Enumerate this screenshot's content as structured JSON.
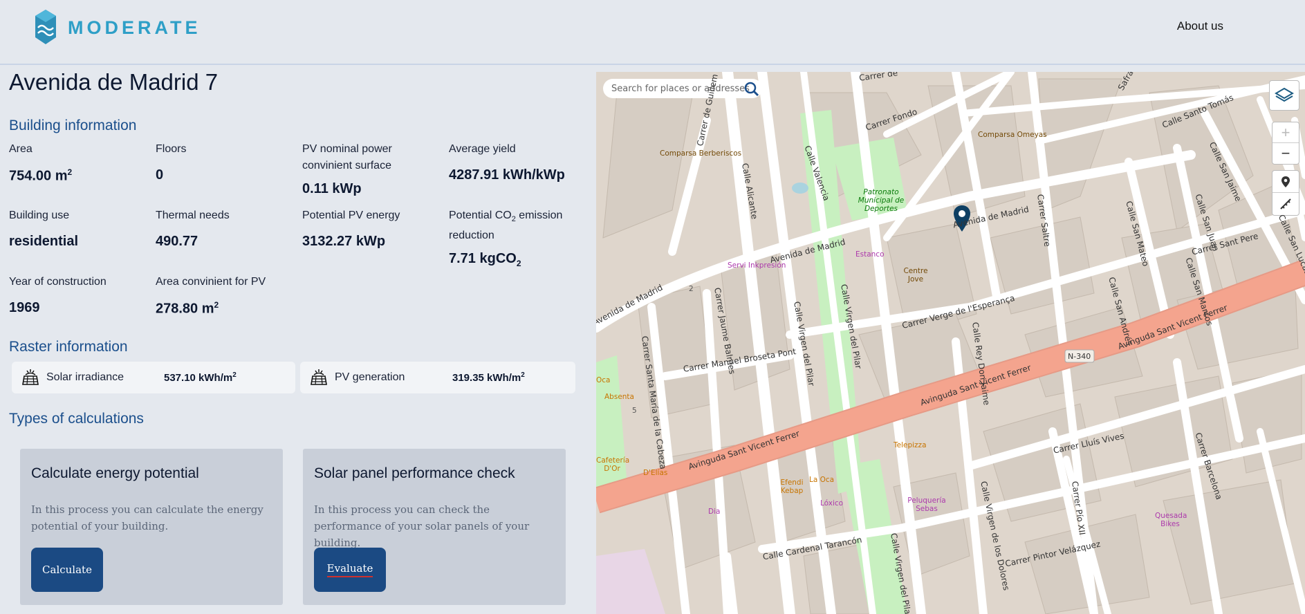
{
  "header": {
    "logo_text": "MODERATE",
    "nav_about": "About us"
  },
  "page_title": "Avenida de Madrid 7",
  "building": {
    "section_title": "Building information",
    "area_label": "Area",
    "area_value": "754.00 m",
    "area_unit_sup": "2",
    "floors_label": "Floors",
    "floors_value": "0",
    "pv_nominal_label": "PV nominal power convinient surface",
    "pv_nominal_value": "0.11 kWp",
    "avg_yield_label": "Average yield",
    "avg_yield_value": "4287.91 kWh/kWp",
    "use_label": "Building use",
    "use_value": "residential",
    "thermal_label": "Thermal needs",
    "thermal_value": "490.77",
    "pv_energy_label": "Potential PV energy",
    "pv_energy_value": "3132.27 kWp",
    "co2_label_pre": "Potential CO",
    "co2_label_sub": "2",
    "co2_label_post": " emission reduction",
    "co2_value": "7.71 kgCO",
    "co2_value_sub": "2",
    "year_label": "Year of construction",
    "year_value": "1969",
    "pv_area_label": "Area convinient for PV",
    "pv_area_value": "278.80 m",
    "pv_area_sup": "2"
  },
  "raster": {
    "section_title": "Raster information",
    "solar_label": "Solar irradiance",
    "solar_value": "537.10 kWh/m",
    "solar_sup": "2",
    "pvgen_label": "PV generation",
    "pvgen_value": "319.35 kWh/m",
    "pvgen_sup": "2"
  },
  "calculations": {
    "section_title": "Types of calculations",
    "card1_title": "Calculate energy potential",
    "card1_text": "In this process you can calculate the energy potential of your building.",
    "card1_button": "Calculate",
    "card2_title": "Solar panel performance check",
    "card2_text": "In this process you can check the performance of your solar panels of your building.",
    "card2_button": "Evaluate"
  },
  "map": {
    "search_placeholder": "Search for places or addresses",
    "zoom_in": "+",
    "zoom_out": "−",
    "streets": {
      "avenida_madrid_1": "Avenida de Madrid",
      "avenida_madrid_2": "Avenida de Madrid",
      "avenida_madrid_3": "Avenida de Madrid",
      "sant_vicent_1": "Avinguda Sant Vicent Ferrer",
      "sant_vicent_2": "Avinguda Sant Vicent Ferrer",
      "sant_vicent_3": "Avinguda Sant Vicent Ferrer",
      "n340": "N-340",
      "alicante": "Calle Alicante",
      "valencia": "Calle Valencia",
      "guillem": "Carrer de Guillem Magro",
      "fondo": "Carrer Fondo",
      "santo_tomas": "Calle Santo Tomás",
      "saltre": "Carrer Saltre",
      "verge": "Carrer Verge de l'Esperança",
      "broseta": "Carrer Manuel Broseta Pont",
      "jaume_balmes": "Carrer Jaume Balmes",
      "virgen_pilar_1": "Calle Virgen del Pilar",
      "virgen_pilar_2": "Calle Virgen del Pilar",
      "virgen_pilar_3": "Calle Virgen del Pilar",
      "santa_maria": "Carrer Santa María de la Cabeza",
      "rey_don_jaime": "Calle Rey Don Jaime",
      "lluis_vives": "Carrer Lluís Vives",
      "san_mateo": "Calle San Mateo",
      "sant_pere": "Carrer Sant Pere",
      "san_andres": "Calle San Andrés",
      "san_marcos": "Calle San Marcos",
      "san_juan": "Calle San Juan",
      "san_jaime": "Calle San Jaime",
      "san_lucas": "Calle San Lucas",
      "cardenal": "Calle Cardenal Tarancón",
      "virgen_dolores": "Calle Virgen de los Dolores",
      "pio_xii": "Carrer Pío XII",
      "pintor": "Carrer Pintor Velázquez",
      "barcelona": "Carrer Barcelona",
      "safra": "Safra",
      "carrer_top": "Carrer de"
    },
    "pois": {
      "comparsa_ber": "Comparsa Berberiscos",
      "comparsa_ome": "Comparsa Omeyas",
      "patronato": "Patronato Municipal de Deportes",
      "servi": "Servi Inkpresión",
      "estanco": "Estanco",
      "centre_jove": "Centre Jove",
      "absenta": "Absenta",
      "cafeteria": "Cafetería D'Or",
      "delias": "D'Elías",
      "oca_left": "Oca",
      "telepizza": "Telepizza",
      "efendi": "Efendi Kebap",
      "la_oca": "La Oca",
      "loxico": "Lóxico",
      "peluqueria": "Peluquería Sebas",
      "dia": "Dia",
      "quesada": "Quesada Bikes",
      "num2": "2",
      "num5": "5"
    }
  },
  "colors": {
    "accent": "#1b4f8c",
    "button": "#1b4a83",
    "card": "#c9cfd9",
    "logo": "#2e9fc7",
    "map_road_main": "#f4a48e",
    "map_park": "#c8f0c0",
    "map_building": "#d6cdc3"
  }
}
